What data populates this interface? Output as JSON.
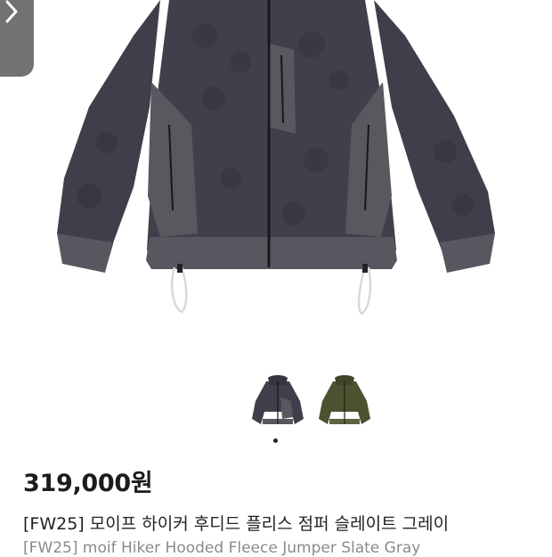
{
  "nav": {
    "prev_icon": "chevron-right-icon"
  },
  "gallery": {
    "thumbnails": [
      {
        "name": "slate-gray"
      },
      {
        "name": "olive"
      }
    ],
    "active_index": 0
  },
  "product": {
    "price": "319,000원",
    "title": "[FW25] 모이프 하이커 후디드 플리스 점퍼 슬레이트 그레이",
    "subtitle": "[FW25] moif Hiker Hooded Fleece Jumper Slate Gray"
  },
  "colors": {
    "fleece": "#3e3f4a",
    "nylon": "#5b575f",
    "olive": "#4b5230",
    "button_bg": "#727272"
  }
}
